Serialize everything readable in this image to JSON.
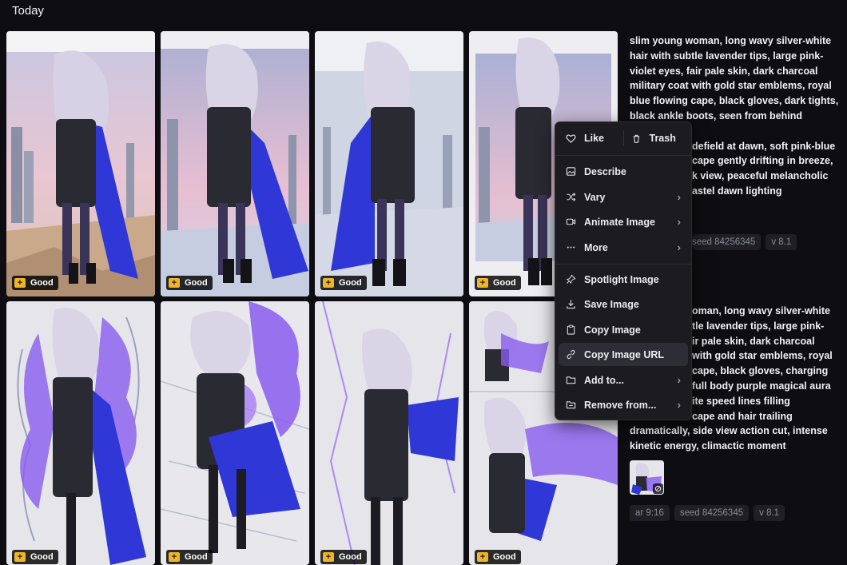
{
  "section": {
    "title": "Today"
  },
  "badge": {
    "plus": "+",
    "label": "Good"
  },
  "prompts": [
    {
      "text_visible": "slim young woman, long wavy silver-white hair with subtle lavender tips, large pink-violet eyes, fair pale skin, dark charcoal military coat with gold star emblems, royal blue flowing cape, black gloves, dark tights, black ankle boots, seen from behind standing ... defield at dawn, soft pink-blue ... cape gently drifting in breeze, ... k view, peaceful melancholic ... astel dawn lighting",
      "lines": [
        "slim young woman, long wavy silver-white",
        "hair with subtle lavender tips, large pink-",
        "violet eyes, fair pale skin, dark charcoal",
        "military coat with gold star emblems, royal",
        "blue flowing cape, black gloves, dark tights,",
        "black ankle boots, seen from behind standing",
        "defield at dawn, soft pink-blue",
        "cape gently drifting in breeze,",
        "k view, peaceful melancholic",
        "astel dawn lighting"
      ],
      "chips": [
        "seed 84256345",
        "v 8.1"
      ]
    },
    {
      "lines": [
        "oman, long wavy silver-white",
        "tle lavender tips, large pink-",
        "ir pale skin, dark charcoal",
        "with gold star emblems, royal",
        "cape, black gloves, charging",
        "full body purple magical aura",
        "ite speed lines filling",
        "cape and hair trailing",
        "dramatically, side view action cut, intense",
        "kinetic energy, climactic moment"
      ],
      "chips": [
        "ar 9:16",
        "seed 84256345",
        "v 8.1"
      ]
    }
  ],
  "context_menu": {
    "like": "Like",
    "trash": "Trash",
    "items": [
      {
        "label": "Describe",
        "icon": "image-icon",
        "submenu": false
      },
      {
        "label": "Vary",
        "icon": "shuffle-icon",
        "submenu": true
      },
      {
        "label": "Animate Image",
        "icon": "video-icon",
        "submenu": true
      },
      {
        "label": "More",
        "icon": "ellipsis-icon",
        "submenu": true
      }
    ],
    "items2": [
      {
        "label": "Spotlight Image",
        "icon": "pin-icon",
        "submenu": false
      },
      {
        "label": "Save Image",
        "icon": "download-icon",
        "submenu": false
      },
      {
        "label": "Copy Image",
        "icon": "clipboard-icon",
        "submenu": false
      },
      {
        "label": "Copy Image URL",
        "icon": "link-icon",
        "submenu": false,
        "active": true
      },
      {
        "label": "Add to...",
        "icon": "folder-icon",
        "submenu": true
      },
      {
        "label": "Remove from...",
        "icon": "folder-minus-icon",
        "submenu": true
      }
    ],
    "arrow": "›"
  },
  "colors": {
    "background": "#0e0e12",
    "badge_accent": "#f0b429",
    "cape_blue": "#2f37d6",
    "aura_purple": "#8a5cf0"
  }
}
